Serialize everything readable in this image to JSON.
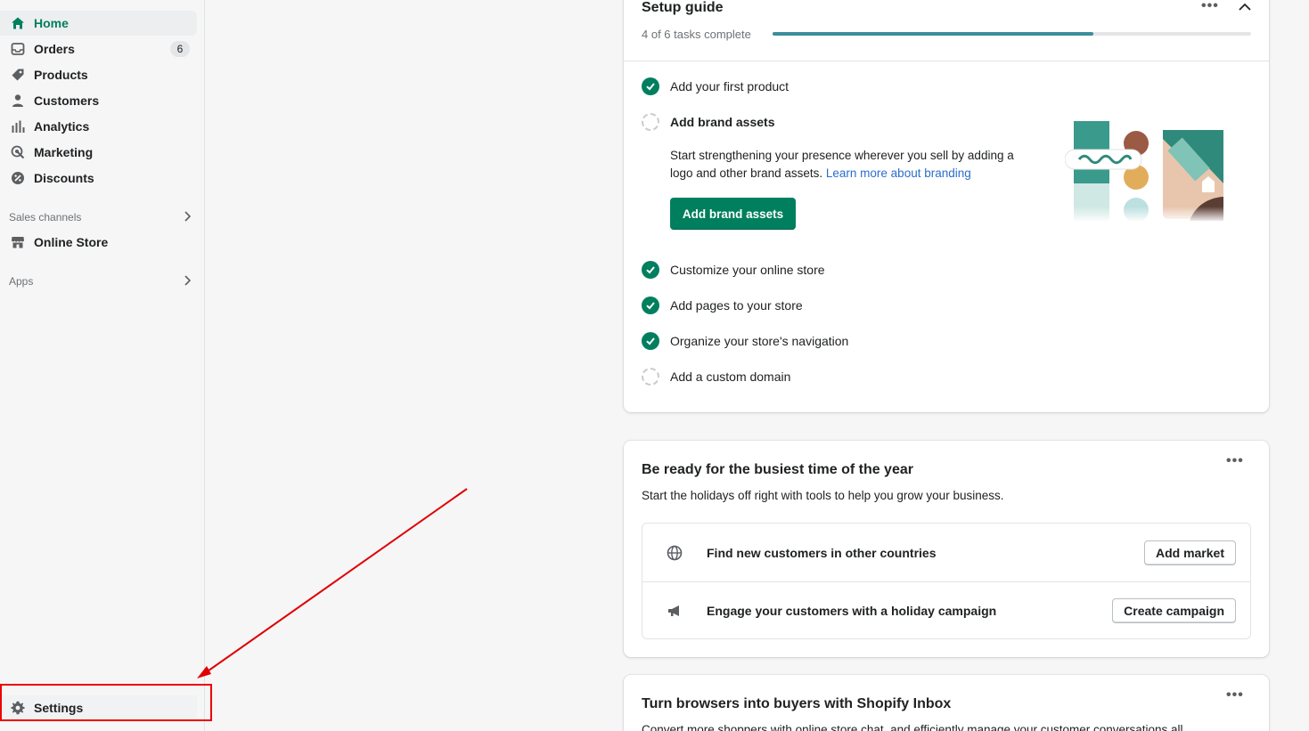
{
  "sidebar": {
    "items": [
      {
        "label": "Home",
        "icon": "home-icon"
      },
      {
        "label": "Orders",
        "icon": "orders-icon",
        "badge": "6"
      },
      {
        "label": "Products",
        "icon": "tag-icon"
      },
      {
        "label": "Customers",
        "icon": "person-icon"
      },
      {
        "label": "Analytics",
        "icon": "bar-chart-icon"
      },
      {
        "label": "Marketing",
        "icon": "target-icon"
      },
      {
        "label": "Discounts",
        "icon": "discount-icon"
      }
    ],
    "sales_channels_label": "Sales channels",
    "online_store_label": "Online Store",
    "apps_label": "Apps",
    "settings_label": "Settings"
  },
  "setup_guide": {
    "title": "Setup guide",
    "progress_text": "4 of 6 tasks complete",
    "progress": 0.67,
    "tasks": [
      {
        "label": "Add your first product",
        "done": true
      },
      {
        "label": "Add brand assets",
        "done": false
      },
      {
        "label": "Customize your online store",
        "done": true
      },
      {
        "label": "Add pages to your store",
        "done": true
      },
      {
        "label": "Organize your store's navigation",
        "done": true
      },
      {
        "label": "Add a custom domain",
        "done": false
      }
    ],
    "brand_desc": "Start strengthening your presence wherever you sell by adding a logo and other brand assets.",
    "brand_link": "Learn more about branding",
    "brand_button": "Add brand assets"
  },
  "holiday_card": {
    "title": "Be ready for the busiest time of the year",
    "subtitle": "Start the holidays off right with tools to help you grow your business.",
    "rows": [
      {
        "label": "Find new customers in other countries",
        "button": "Add market",
        "icon": "globe-icon"
      },
      {
        "label": "Engage your customers with a holiday campaign",
        "button": "Create campaign",
        "icon": "megaphone-icon"
      }
    ]
  },
  "inbox_card": {
    "title": "Turn browsers into buyers with Shopify Inbox",
    "text": "Convert more shoppers with online store chat, and efficiently manage your customer conversations all"
  },
  "colors": {
    "accent": "#007f5f",
    "progress": "#3c8d9c",
    "annotation": "#e00000"
  }
}
